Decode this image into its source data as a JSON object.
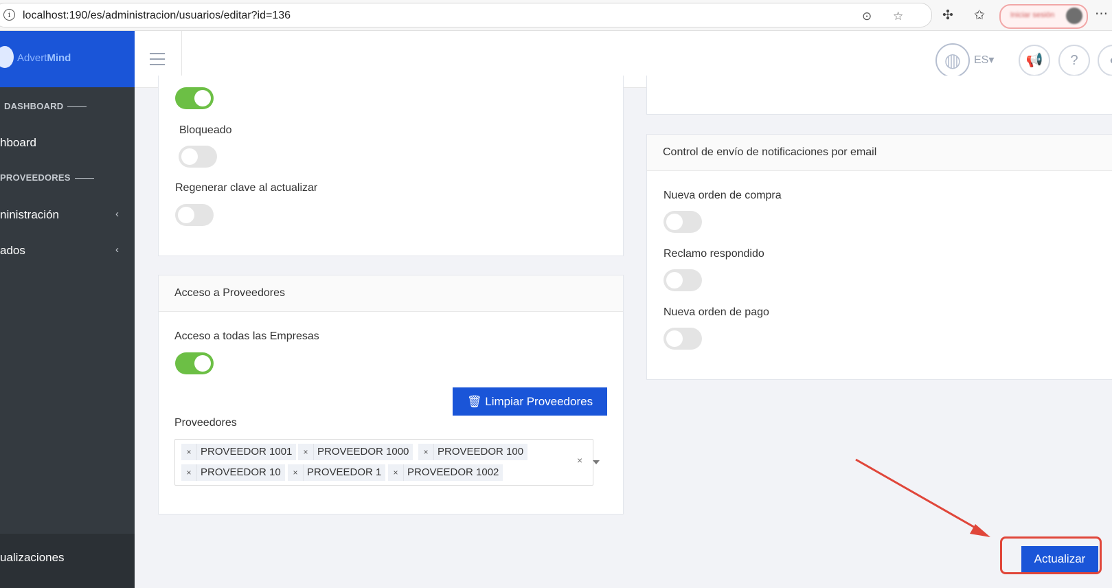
{
  "browser": {
    "url": "localhost:190/es/administracion/usuarios/editar?id=136",
    "profile_label": "Iniciar sesión"
  },
  "brand": {
    "name_a": "Advert",
    "name_b": "Mind"
  },
  "header": {
    "language": "ES▾"
  },
  "sidebar": {
    "sections": [
      "DASHBOARD",
      "PROVEEDORES"
    ],
    "items": [
      {
        "label": "hboard"
      },
      {
        "label": "ninistración"
      },
      {
        "label": "ados"
      }
    ],
    "bottom_item": "ualizaciones"
  },
  "left_top_card": {
    "bloqueado_label": "Bloqueado",
    "regenerar_label": "Regenerar clave al actualizar"
  },
  "access_card": {
    "title": "Acceso a Proveedores",
    "all_companies_label": "Acceso a todas las Empresas",
    "clear_button": "Limpiar Proveedores",
    "providers_label": "Proveedores",
    "providers_row1": [
      "PROVEEDOR 1001",
      "PROVEEDOR 1000",
      "PROVEEDOR 100"
    ],
    "providers_row2": [
      "PROVEEDOR 10",
      "PROVEEDOR 1",
      "PROVEEDOR 1002"
    ]
  },
  "notif_card": {
    "title": "Control de envío de notificaciones por email",
    "items": [
      "Nueva orden de compra",
      "Reclamo respondido",
      "Nueva orden de pago"
    ]
  },
  "actions": {
    "update_button": "Actualizar"
  },
  "colors": {
    "primary": "#1a55d8",
    "toggle_on": "#6cbf45",
    "annotation": "#e0463a"
  }
}
